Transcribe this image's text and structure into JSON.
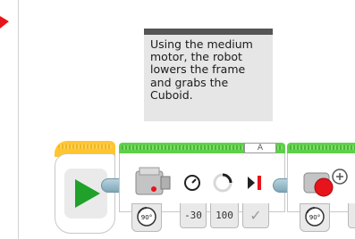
{
  "comment": {
    "text": "Using the medium\nmotor, the robot\nlowers the frame\nand grabs the\nCuboid."
  },
  "motor_block": {
    "port": "A",
    "power": "-30",
    "degrees": "100"
  },
  "colors": {
    "start_yellow": "#ffc632",
    "action_green": "#5ed04a",
    "play_green": "#1fa12a",
    "marker_red": "#e8141b",
    "comment_bg": "#e6e6e6"
  },
  "icons": [
    "corner-marker-icon",
    "play-icon",
    "medium-motor-icon",
    "speed-dial-icon",
    "rotation-icon",
    "brake-icon",
    "large-motor-icon",
    "mode-90-icon",
    "checkmark-icon"
  ]
}
